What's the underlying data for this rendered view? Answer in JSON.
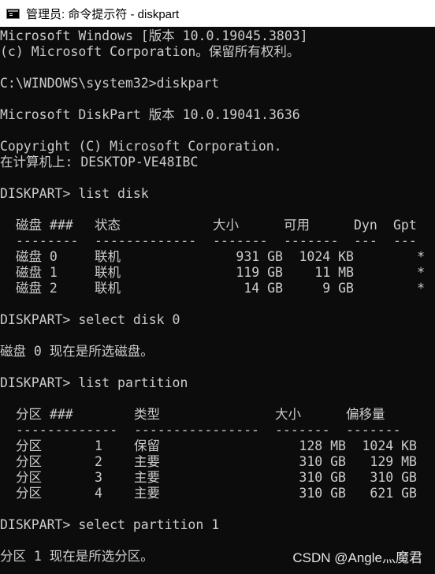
{
  "window": {
    "title": "管理员: 命令提示符 - diskpart",
    "icon": "cmd-icon"
  },
  "console": {
    "header_lines": [
      "Microsoft Windows [版本 10.0.19045.3803]",
      "(c) Microsoft Corporation。保留所有权利。",
      "",
      "C:\\WINDOWS\\system32>diskpart",
      "",
      "Microsoft DiskPart 版本 10.0.19041.3636",
      "",
      "Copyright (C) Microsoft Corporation.",
      "在计算机上: DESKTOP-VE48IBC",
      "",
      "DISKPART> list disk",
      ""
    ],
    "disk_table": {
      "headers": [
        "磁盘 ###",
        "状态",
        "大小",
        "可用",
        "Dyn",
        "Gpt"
      ],
      "separators": [
        "--------",
        "-------------",
        "-------",
        "-------",
        "---",
        "---"
      ],
      "rows": [
        {
          "disk": "磁盘 0",
          "status": "联机",
          "size": "931 GB",
          "free": "1024 KB",
          "dyn": "",
          "gpt": "*"
        },
        {
          "disk": "磁盘 1",
          "status": "联机",
          "size": "119 GB",
          "free": "11 MB",
          "dyn": "",
          "gpt": "*"
        },
        {
          "disk": "磁盘 2",
          "status": "联机",
          "size": "14 GB",
          "free": "9 GB",
          "dyn": "",
          "gpt": "*"
        }
      ]
    },
    "middle_lines": [
      "",
      "DISKPART> select disk 0",
      "",
      "磁盘 0 现在是所选磁盘。",
      "",
      "DISKPART> list partition",
      ""
    ],
    "partition_table": {
      "headers": [
        "分区 ###",
        "类型",
        "大小",
        "偏移量"
      ],
      "separators": [
        "-------------",
        "----------------",
        "-------",
        "-------"
      ],
      "rows": [
        {
          "label": "分区",
          "num": "1",
          "type": "保留",
          "size": "128 MB",
          "offset": "1024 KB"
        },
        {
          "label": "分区",
          "num": "2",
          "type": "主要",
          "size": "310 GB",
          "offset": "129 MB"
        },
        {
          "label": "分区",
          "num": "3",
          "type": "主要",
          "size": "310 GB",
          "offset": "310 GB"
        },
        {
          "label": "分区",
          "num": "4",
          "type": "主要",
          "size": "310 GB",
          "offset": "621 GB"
        }
      ]
    },
    "footer_lines": [
      "",
      "DISKPART> select partition 1",
      "",
      "分区 1 现在是所选分区。"
    ]
  },
  "watermark": "CSDN @Angle灬魔君",
  "colors": {
    "background": "#0c0c0c",
    "text": "#cccccc",
    "titlebar": "#ffffff"
  }
}
